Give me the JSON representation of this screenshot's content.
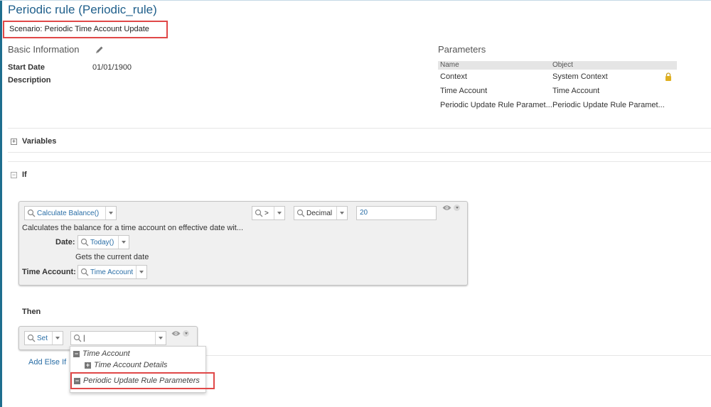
{
  "page": {
    "title": "Periodic rule (Periodic_rule)",
    "scenario": "Scenario: Periodic Time Account Update"
  },
  "basic_info": {
    "title": "Basic Information",
    "edit_icon": "pencil-icon",
    "start_date_label": "Start Date",
    "start_date_value": "01/01/1900",
    "description_label": "Description"
  },
  "parameters": {
    "title": "Parameters",
    "columns": [
      "Name",
      "Object"
    ],
    "rows": [
      {
        "name": "Context",
        "object": "System Context",
        "locked": true
      },
      {
        "name": "Time Account",
        "object": "Time Account",
        "locked": false
      },
      {
        "name": "Periodic Update Rule Paramet...",
        "object": "Periodic Update Rule Paramet...",
        "locked": false
      }
    ]
  },
  "variables": {
    "label": "Variables",
    "expander": "+"
  },
  "if_section": {
    "label": "If",
    "expander": "−",
    "left_expression": "Calculate Balance()",
    "operator": ">",
    "type": "Decimal",
    "compare_value": "20",
    "function_description": "Calculates the balance for a time account on effective date wit...",
    "date_label": "Date:",
    "date_value": "Today()",
    "date_description": "Gets the current date",
    "time_account_label": "Time Account:",
    "time_account_value": "Time Account"
  },
  "then_section": {
    "label": "Then",
    "action": "Set",
    "target_value": "|",
    "dropdown_items": [
      {
        "label": "Time Account",
        "marker": "−"
      },
      {
        "label": "Time Account Details",
        "marker": "+"
      },
      {
        "label": "Periodic Update Rule Parameters",
        "marker": "−"
      }
    ]
  },
  "add_else_if": "Add Else If",
  "colors": {
    "title_blue": "#1f5f8b",
    "link_blue": "#2a6ea6",
    "highlight_red": "#e04848",
    "lock_gold": "#e0b020"
  }
}
